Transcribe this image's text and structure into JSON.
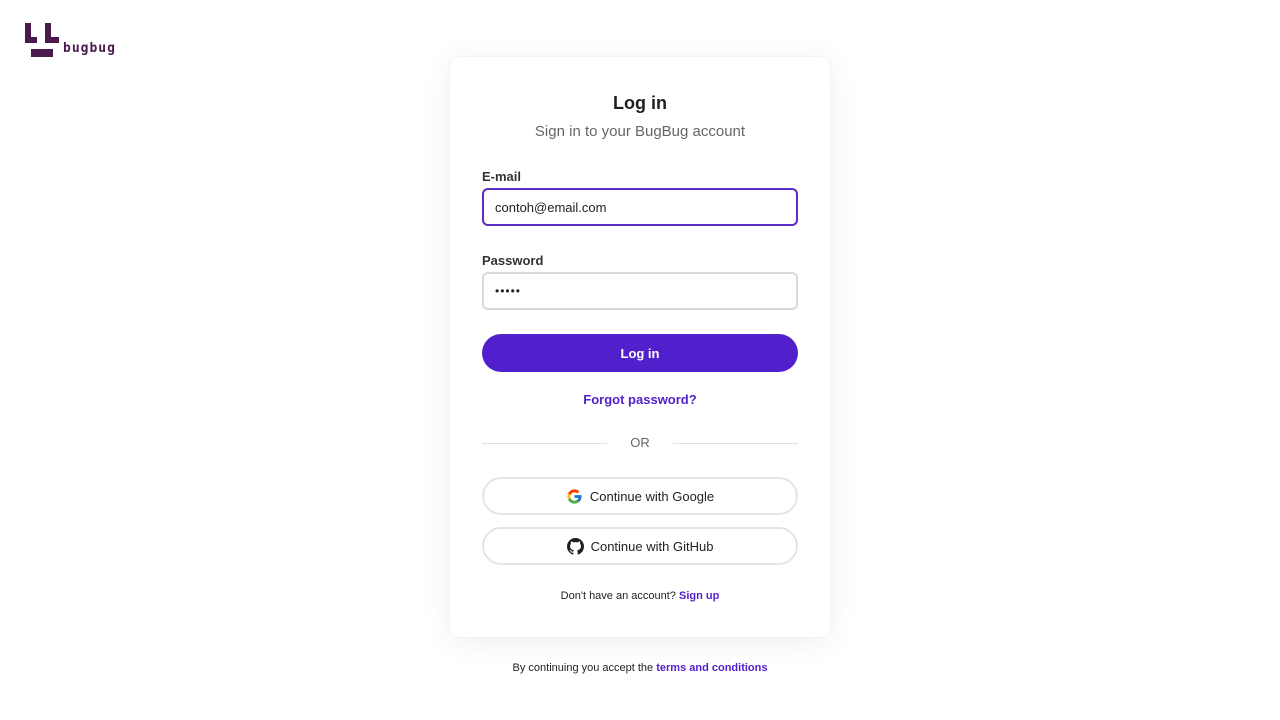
{
  "brand": {
    "logo_text": "bugbug",
    "color": "#4a1a4f"
  },
  "card": {
    "title": "Log in",
    "subtitle": "Sign in to your BugBug account"
  },
  "form": {
    "email": {
      "label": "E-mail",
      "value": "contoh@email.com"
    },
    "password": {
      "label": "Password",
      "value": "•••••"
    },
    "submit_label": "Log in",
    "forgot_label": "Forgot password?"
  },
  "divider_text": "OR",
  "oauth": {
    "google": {
      "label": "Continue with Google",
      "icon": "google-icon"
    },
    "github": {
      "label": "Continue with GitHub",
      "icon": "github-icon"
    }
  },
  "signup": {
    "prompt": "Don't have an account?",
    "link": "Sign up"
  },
  "terms": {
    "prefix": "By continuing you accept the",
    "link": "terms and conditions"
  },
  "colors": {
    "accent": "#521fcc",
    "focus_border": "#5b2bc8"
  }
}
